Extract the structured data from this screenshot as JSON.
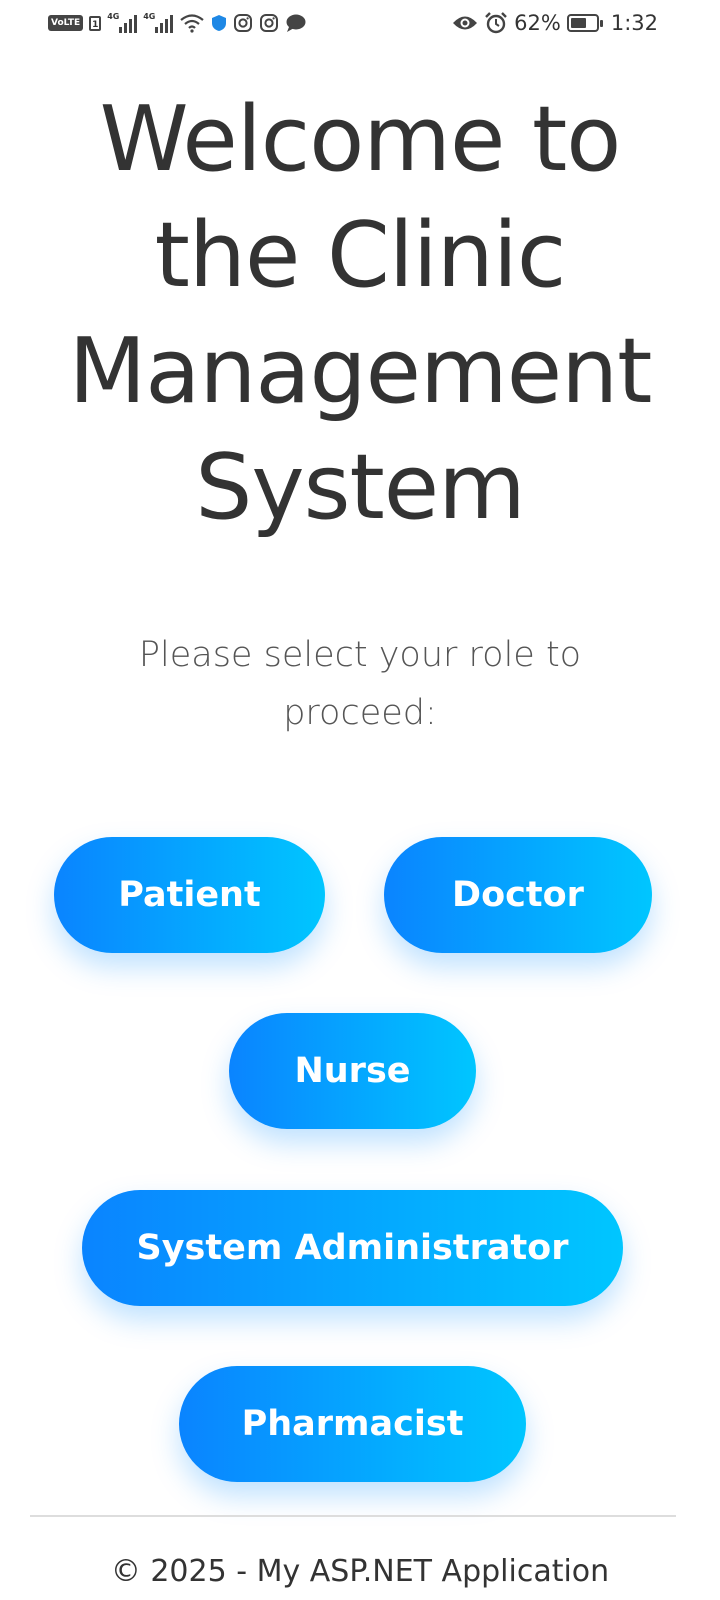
{
  "status_bar": {
    "volte_label": "VoLTE",
    "sim_label": "1",
    "network_1": "4G",
    "network_2": "4G",
    "battery_percent_text": "62%",
    "battery_level": 0.62,
    "time": "1:32",
    "icons": [
      "volte-icon",
      "sim-icon",
      "signal-icon",
      "signal-icon",
      "wifi-icon",
      "shield-icon",
      "instagram-icon",
      "instagram-icon",
      "chat-bubble-icon",
      "eye-icon",
      "alarm-icon",
      "battery-icon"
    ]
  },
  "main": {
    "title": "Welcome to the Clinic Management System",
    "subtitle": "Please select your role to proceed:",
    "roles": {
      "patient": "Patient",
      "doctor": "Doctor",
      "nurse": "Nurse",
      "admin": "System Administrator",
      "pharmacist": "Pharmacist"
    }
  },
  "footer": {
    "text": "© 2025 - My ASP.NET Application"
  },
  "colors": {
    "button_gradient_start": "#0a84ff",
    "button_gradient_end": "#00c6ff",
    "button_text": "#ffffff",
    "title_text": "#333333",
    "background": "#ffffff"
  }
}
